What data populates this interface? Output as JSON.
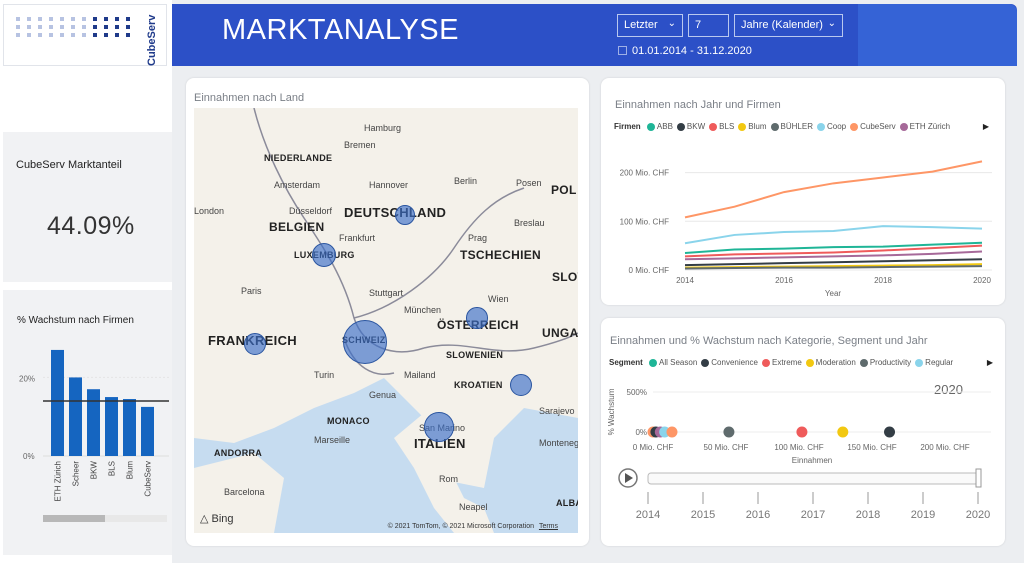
{
  "header": {
    "title": "MARKTANALYSE",
    "filter_mode": "Letzter",
    "filter_count": "7",
    "filter_unit": "Jahre (Kalender)",
    "date_range": "01.01.2014 - 31.12.2020",
    "accent_color": "#2c50c7"
  },
  "logo": {
    "text": "CubeServ"
  },
  "kpi": {
    "label": "CubeServ Marktanteil",
    "value": "44.09%"
  },
  "growth_chart": {
    "title": "% Wachstum nach Firmen",
    "yticks": [
      "20%",
      "0%"
    ],
    "chart_data": {
      "type": "bar",
      "categories": [
        "ETH Zürich",
        "Scheer",
        "BKW",
        "BLS",
        "Blum",
        "CubeServ"
      ],
      "values": [
        27,
        20,
        17,
        15,
        14.5,
        12.5
      ],
      "reference_line": 14,
      "ylim": [
        0,
        28
      ],
      "color": "#1565c0"
    }
  },
  "map_card": {
    "title": "Einnahmen nach Land",
    "countries": [
      {
        "name": "NIEDERLANDE"
      },
      {
        "name": "DEUTSCHLAND"
      },
      {
        "name": "BELGIEN"
      },
      {
        "name": "TSCHECHIEN"
      },
      {
        "name": "POL"
      },
      {
        "name": "SLOW"
      },
      {
        "name": "FRANKREICH"
      },
      {
        "name": "ÖSTERREICH"
      },
      {
        "name": "UNGA"
      },
      {
        "name": "SLOWENIEN"
      },
      {
        "name": "KROATIEN"
      },
      {
        "name": "ITALIEN"
      },
      {
        "name": "MONACO"
      },
      {
        "name": "ANDORRA"
      },
      {
        "name": "ALBA"
      },
      {
        "name": "SCHWEIZ"
      },
      {
        "name": "LUXEMBURG"
      }
    ],
    "cities": [
      "Hamburg",
      "Bremen",
      "Amsterdam",
      "Hannover",
      "Berlin",
      "Posen",
      "Düsseldorf",
      "London",
      "Frankfurt",
      "Prag",
      "Breslau",
      "Paris",
      "Stuttgart",
      "München",
      "Wien",
      "Turin",
      "Mailand",
      "Genua",
      "Marseille",
      "San Marino",
      "Rom",
      "Neapel",
      "Barcelona",
      "Sarajevo",
      "Montenegro"
    ],
    "bubbles": [
      {
        "country": "SCHWEIZ",
        "size": 1.0
      },
      {
        "country": "ITALIEN",
        "size": 0.55
      },
      {
        "country": "FRANKREICH",
        "size": 0.32
      },
      {
        "country": "DEUTSCHLAND",
        "size": 0.25
      },
      {
        "country": "LUXEMBURG",
        "size": 0.38
      },
      {
        "country": "ÖSTERREICH",
        "size": 0.3
      },
      {
        "country": "KROATIEN",
        "size": 0.33
      }
    ],
    "attribution": "© 2021 TomTom, © 2021 Microsoft Corporation",
    "terms": "Terms",
    "bing": "Bing"
  },
  "line_card": {
    "title": "Einnahmen nach Jahr und Firmen",
    "legend_title": "Firmen",
    "legend": [
      {
        "name": "ABB",
        "color": "#1fb597"
      },
      {
        "name": "BKW",
        "color": "#333d45"
      },
      {
        "name": "BLS",
        "color": "#ef5b5b"
      },
      {
        "name": "Blum",
        "color": "#f2c811"
      },
      {
        "name": "BÜHLER",
        "color": "#5f6b6d"
      },
      {
        "name": "Coop",
        "color": "#8ad4eb"
      },
      {
        "name": "CubeServ",
        "color": "#fe9666"
      },
      {
        "name": "ETH Zürich",
        "color": "#a66999"
      }
    ],
    "ytick_labels": [
      "200 Mio. CHF",
      "100 Mio. CHF",
      "0 Mio. CHF"
    ],
    "xtick_labels": [
      "2014",
      "2016",
      "2018",
      "2020"
    ],
    "xlabel": "Year",
    "chart_data": {
      "type": "line",
      "x": [
        2014,
        2015,
        2016,
        2017,
        2018,
        2019,
        2020
      ],
      "ylim": [
        0,
        230
      ],
      "series": [
        {
          "name": "CubeServ",
          "values": [
            108,
            130,
            160,
            178,
            190,
            202,
            223
          ]
        },
        {
          "name": "Coop",
          "values": [
            55,
            72,
            78,
            80,
            90,
            88,
            85
          ]
        },
        {
          "name": "ABB",
          "values": [
            35,
            42,
            44,
            47,
            48,
            52,
            56
          ]
        },
        {
          "name": "BLS",
          "values": [
            28,
            32,
            34,
            36,
            40,
            45,
            50
          ]
        },
        {
          "name": "ETH Zürich",
          "values": [
            22,
            24,
            26,
            28,
            30,
            33,
            38
          ]
        },
        {
          "name": "BKW",
          "values": [
            10,
            12,
            14,
            16,
            18,
            20,
            22
          ]
        },
        {
          "name": "Blum",
          "values": [
            5,
            6,
            7,
            8,
            9,
            10,
            12
          ]
        },
        {
          "name": "BÜHLER",
          "values": [
            3,
            4,
            5,
            5,
            6,
            7,
            8
          ]
        }
      ]
    }
  },
  "scatter_card": {
    "title": "Einnahmen und % Wachstum nach Kategorie, Segment und Jahr",
    "legend_title": "Segment",
    "legend": [
      {
        "name": "All Season",
        "color": "#1fb597"
      },
      {
        "name": "Convenience",
        "color": "#333d45"
      },
      {
        "name": "Extreme",
        "color": "#ef5b5b"
      },
      {
        "name": "Moderation",
        "color": "#f2c811"
      },
      {
        "name": "Productivity",
        "color": "#5f6b6d"
      },
      {
        "name": "Regular",
        "color": "#8ad4eb"
      }
    ],
    "year_label": "2020",
    "ytick_labels": [
      "500%",
      "0%"
    ],
    "xtick_labels": [
      "0 Mio. CHF",
      "50 Mio. CHF",
      "100 Mio. CHF",
      "150 Mio. CHF",
      "200 Mio. CHF"
    ],
    "xlabel": "Einnahmen",
    "ylabel": "% Wachstum",
    "chart_data": {
      "type": "scatter",
      "xlim": [
        0,
        200
      ],
      "ylim": [
        -50,
        550
      ],
      "points": [
        {
          "x": 0,
          "y": 0,
          "color": "#fe9666"
        },
        {
          "x": 2,
          "y": 0,
          "color": "#333d45"
        },
        {
          "x": 5,
          "y": 0,
          "color": "#a66999"
        },
        {
          "x": 8,
          "y": 0,
          "color": "#8ad4eb"
        },
        {
          "x": 13,
          "y": 0,
          "color": "#fe9666"
        },
        {
          "x": 52,
          "y": 0,
          "color": "#5f6b6d"
        },
        {
          "x": 102,
          "y": 0,
          "color": "#ef5b5b"
        },
        {
          "x": 130,
          "y": 0,
          "color": "#f2c811"
        },
        {
          "x": 162,
          "y": 0,
          "color": "#333d45"
        }
      ]
    },
    "timeline_years": [
      "2014",
      "2015",
      "2016",
      "2017",
      "2018",
      "2019",
      "2020"
    ]
  }
}
